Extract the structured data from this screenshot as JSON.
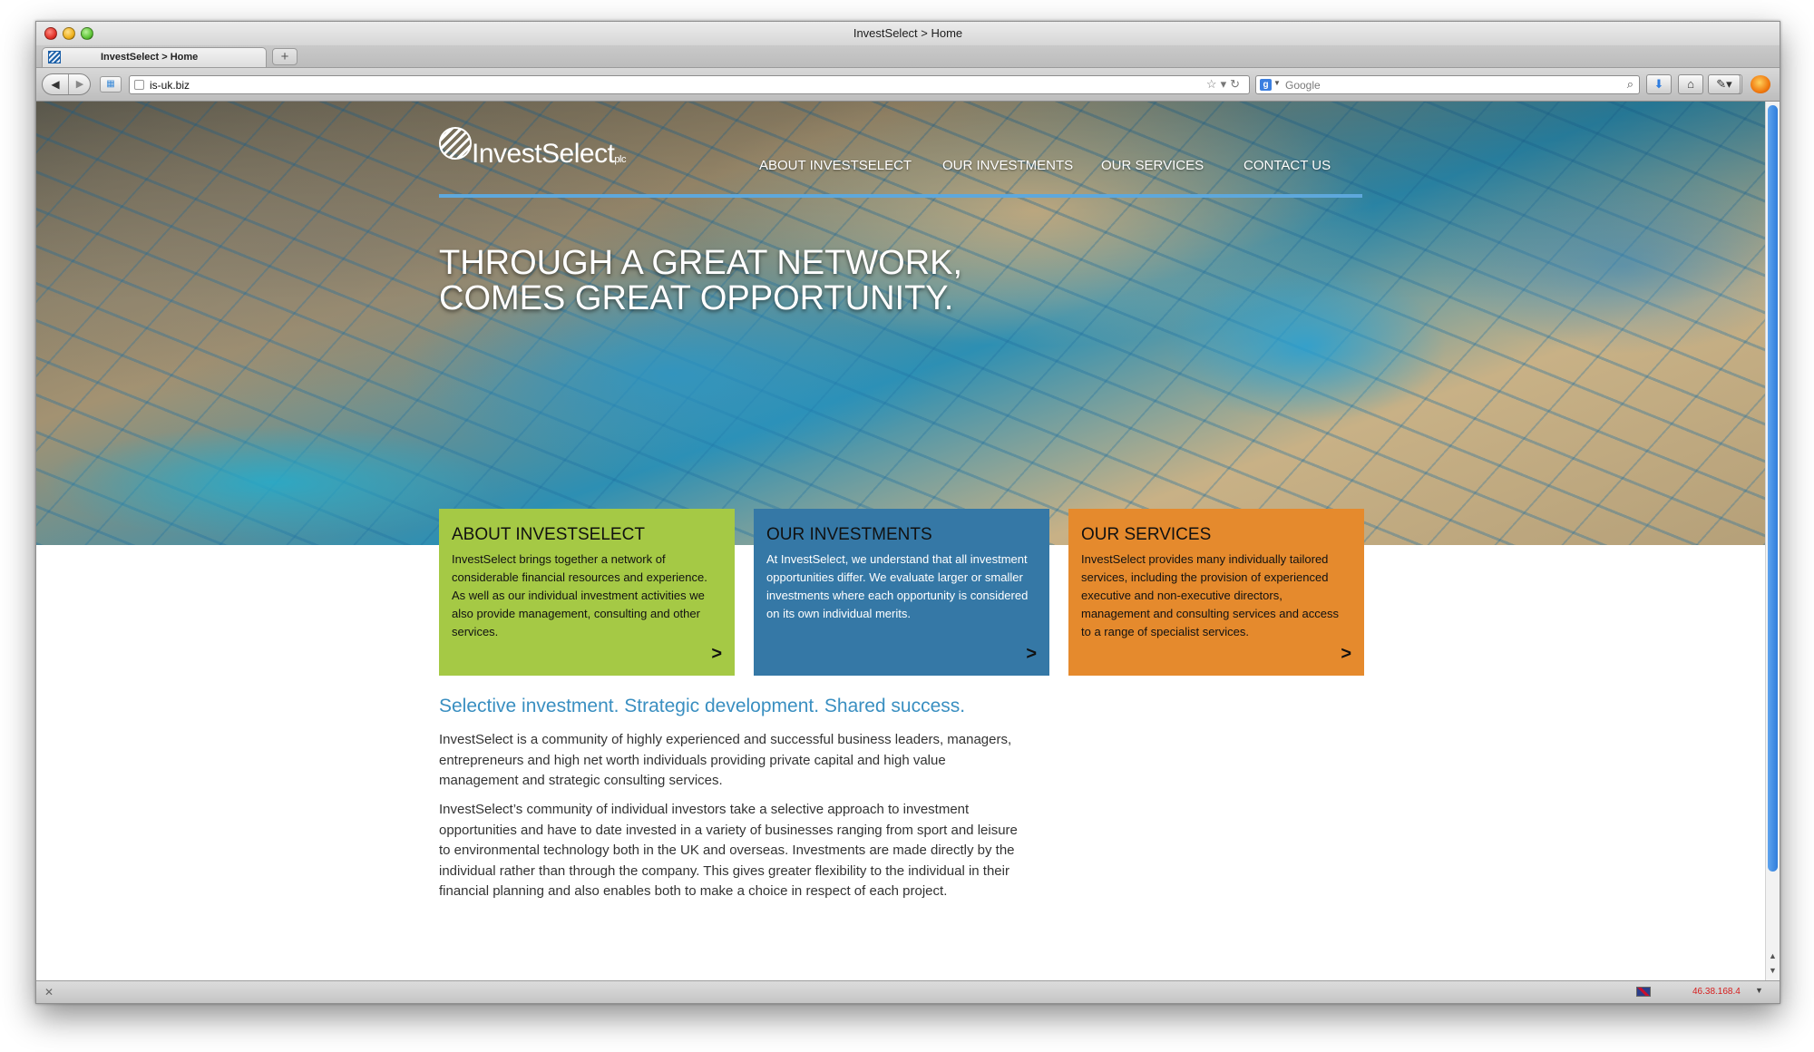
{
  "browser": {
    "window_title": "InvestSelect > Home",
    "tab_title": "InvestSelect > Home",
    "new_tab_label": "+",
    "url": "is-uk.biz",
    "search_placeholder": "Google",
    "status_ip": "46.38.168.4"
  },
  "site": {
    "logo_text": "InvestSelect",
    "logo_suffix": "plc",
    "nav": [
      {
        "label": "ABOUT INVESTSELECT"
      },
      {
        "label": "OUR INVESTMENTS"
      },
      {
        "label": "OUR SERVICES"
      },
      {
        "label": "CONTACT US"
      }
    ],
    "hero_line1": "THROUGH A GREAT NETWORK,",
    "hero_line2": "COMES GREAT OPPORTUNITY.",
    "cards": [
      {
        "title": "ABOUT INVESTSELECT",
        "body": "InvestSelect brings together a network of considerable financial resources and experience. As well as our individual investment activities we also provide management, consulting and other services.",
        "color": "#a5c945"
      },
      {
        "title": "OUR INVESTMENTS",
        "body": "At InvestSelect, we understand that all investment opportunities differ. We evaluate larger or smaller investments where each opportunity is considered on its own individual merits.",
        "color": "#3578a6"
      },
      {
        "title": "OUR SERVICES",
        "body": "InvestSelect provides many individually tailored services, including the provision of experienced executive and non-executive directors, management and consulting services and access to a range of specialist services.",
        "color": "#e58a2d"
      }
    ],
    "card_arrow": ">",
    "tagline": "Selective investment. Strategic development. Shared success.",
    "paragraph1": "InvestSelect is a community of highly experienced and successful business leaders, managers, entrepreneurs and high net worth individuals providing private capital and high value management and strategic consulting services.",
    "paragraph2": "InvestSelect’s community of individual investors take a selective approach to investment opportunities and have to date invested in a variety of businesses ranging from sport and leisure to environmental technology both in the UK and overseas. Investments are made directly by the individual rather than through the company. This gives greater flexibility to the individual in their financial planning and also enables both to make a choice in respect of each project.",
    "accent_color": "#5ea8dc",
    "tagline_color": "#3a8fc1"
  }
}
